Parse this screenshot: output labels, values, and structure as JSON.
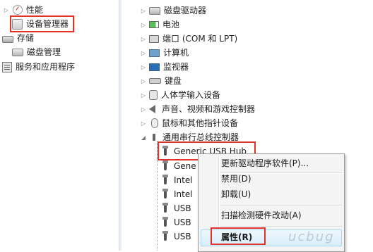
{
  "left_tree": {
    "items": [
      {
        "label": "性能",
        "icon": "performance-icon"
      },
      {
        "label": "设备管理器",
        "icon": "device-manager-icon"
      },
      {
        "label": "存储",
        "icon": "storage-icon"
      },
      {
        "label": "磁盘管理",
        "icon": "disk-management-icon"
      },
      {
        "label": "服务和应用程序",
        "icon": "services-icon"
      }
    ]
  },
  "device_tree": {
    "categories": [
      {
        "label": "磁盘驱动器",
        "icon": "disk-drive-icon"
      },
      {
        "label": "电池",
        "icon": "battery-icon"
      },
      {
        "label": "端口 (COM 和 LPT)",
        "icon": "port-icon"
      },
      {
        "label": "计算机",
        "icon": "computer-icon"
      },
      {
        "label": "监视器",
        "icon": "monitor-icon"
      },
      {
        "label": "键盘",
        "icon": "keyboard-icon"
      },
      {
        "label": "人体学输入设备",
        "icon": "hid-icon"
      },
      {
        "label": "声音、视频和游戏控制器",
        "icon": "sound-icon"
      },
      {
        "label": "鼠标和其他指针设备",
        "icon": "mouse-icon"
      },
      {
        "label": "通用串行总线控制器",
        "icon": "usb-controller-icon"
      }
    ],
    "usb_children": [
      {
        "label": "Generic USB Hub"
      },
      {
        "label": "Gene"
      },
      {
        "label": "Intel"
      },
      {
        "label": "Intel"
      },
      {
        "label": "USB"
      },
      {
        "label": "USB"
      },
      {
        "label": "USB"
      }
    ]
  },
  "context_menu": {
    "items": [
      {
        "label": "更新驱动程序软件(P)..."
      },
      {
        "label": "禁用(D)"
      },
      {
        "label": "卸载(U)"
      },
      {
        "label": "扫描检测硬件改动(A)"
      },
      {
        "label": "属性(R)"
      }
    ]
  },
  "watermark": {
    "text": "ucbug"
  },
  "colors": {
    "highlight_box": "#e0312b",
    "menu_hover": "#d9eefa",
    "menu_background": "#f4f4f4"
  }
}
